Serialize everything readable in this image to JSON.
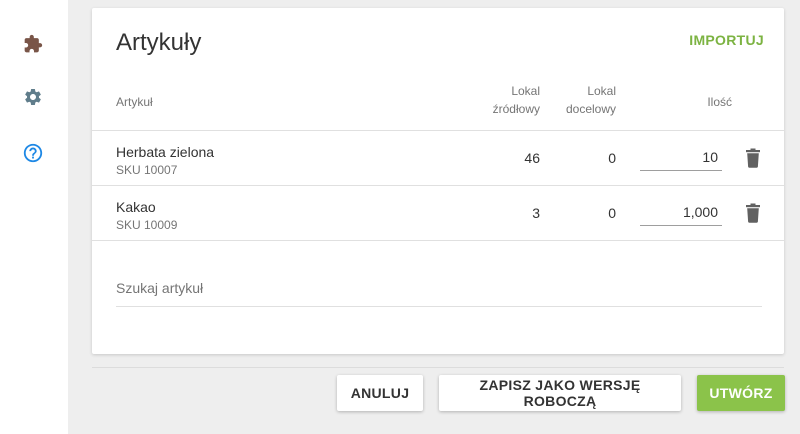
{
  "sidebar": {
    "icons": [
      "puzzle-icon",
      "gear-icon",
      "help-icon"
    ],
    "colors": {
      "puzzle": "#795548",
      "gear": "#607d8b",
      "help": "#1e88e5"
    }
  },
  "card": {
    "title": "Artykuły",
    "import_label": "IMPORTUJ"
  },
  "table": {
    "headers": {
      "item": "Artykuł",
      "source_line1": "Lokal",
      "source_line2": "źródłowy",
      "target_line1": "Lokal",
      "target_line2": "docelowy",
      "quantity": "Ilość"
    },
    "rows": [
      {
        "name": "Herbata zielona",
        "sku": "SKU 10007",
        "source": "46",
        "target": "0",
        "quantity": "10"
      },
      {
        "name": "Kakao",
        "sku": "SKU 10009",
        "source": "3",
        "target": "0",
        "quantity": "1,000"
      }
    ]
  },
  "search": {
    "placeholder": "Szukaj artykuł"
  },
  "footer": {
    "cancel_label": "ANULUJ",
    "draft_label": "ZAPISZ JAKO WERSJĘ ROBOCZĄ",
    "create_label": "UTWÓRZ"
  },
  "colors": {
    "accent": "#8bc34a",
    "link": "#7cb342"
  }
}
